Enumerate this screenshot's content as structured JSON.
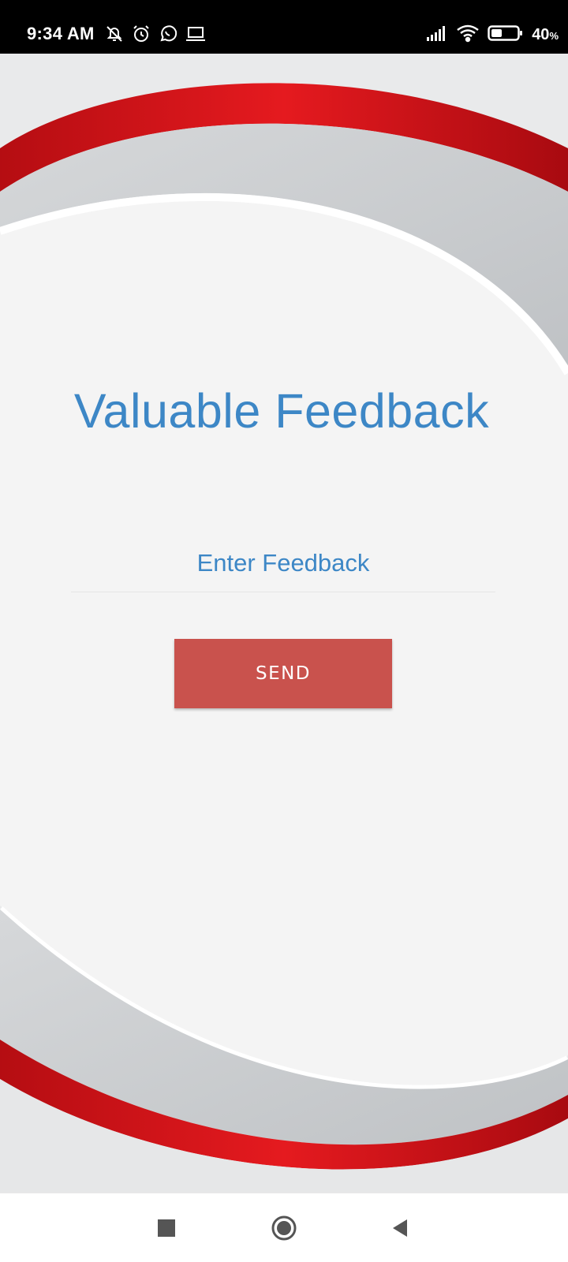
{
  "status_bar": {
    "time": "9:34 AM",
    "left_icons": [
      "bell-off-icon",
      "alarm-icon",
      "whatsapp-icon",
      "laptop-icon"
    ],
    "right_icons": [
      "signal-icon",
      "wifi-icon",
      "battery-icon"
    ],
    "battery_percent": "40",
    "battery_unit": "%",
    "battery_level": 0.4
  },
  "main": {
    "title": "Valuable Feedback",
    "feedback_placeholder": "Enter Feedback",
    "feedback_value": "",
    "send_label": "SEND"
  },
  "nav_bar": {
    "buttons": [
      "recents-icon",
      "home-icon",
      "back-icon"
    ]
  },
  "colors": {
    "accent_blue": "#3d87c6",
    "send_button": "#c9524d",
    "swoosh_red": "#d8141a",
    "background": "#f4f4f4"
  }
}
